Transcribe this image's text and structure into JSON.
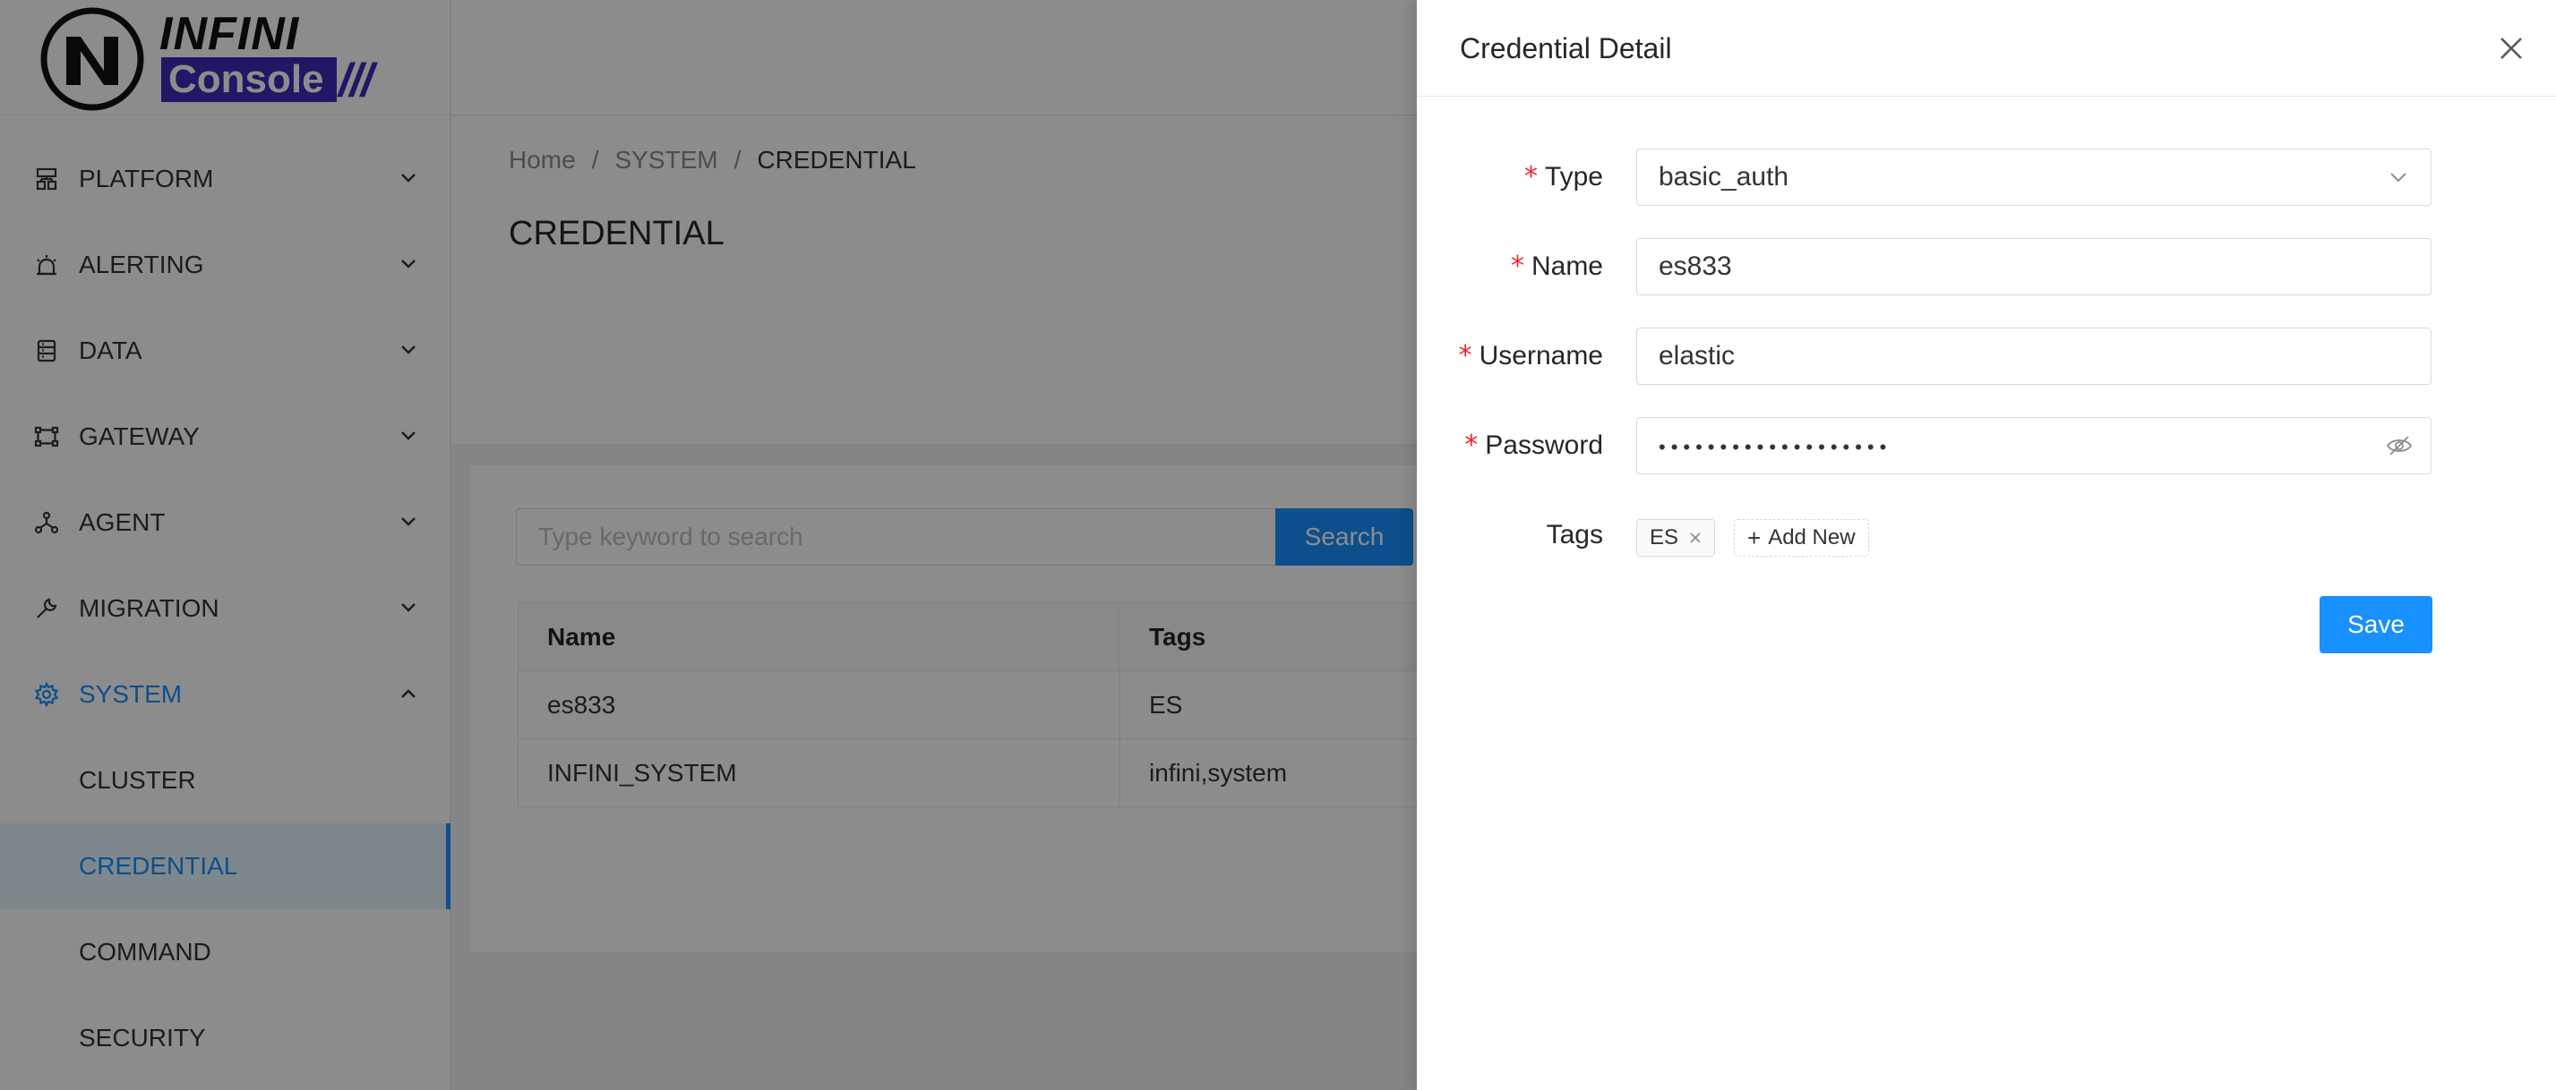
{
  "logo": {
    "top": "INFINI",
    "bottom": "Console",
    "slashes": "///"
  },
  "sidebar": {
    "items": [
      {
        "label": "PLATFORM",
        "icon": "platform-icon"
      },
      {
        "label": "ALERTING",
        "icon": "alarm-icon"
      },
      {
        "label": "DATA",
        "icon": "database-icon"
      },
      {
        "label": "GATEWAY",
        "icon": "gateway-icon"
      },
      {
        "label": "AGENT",
        "icon": "agent-icon"
      },
      {
        "label": "MIGRATION",
        "icon": "wrench-icon"
      },
      {
        "label": "SYSTEM",
        "icon": "gear-icon"
      }
    ],
    "system_children": [
      "CLUSTER",
      "CREDENTIAL",
      "COMMAND",
      "SECURITY"
    ]
  },
  "breadcrumb": [
    "Home",
    "/",
    "SYSTEM",
    "/",
    "CREDENTIAL"
  ],
  "page_title": "CREDENTIAL",
  "search": {
    "placeholder": "Type keyword to search",
    "button": "Search"
  },
  "table": {
    "headers": [
      "Name",
      "Tags"
    ],
    "rows": [
      [
        "es833",
        "ES"
      ],
      [
        "INFINI_SYSTEM",
        "infini,system"
      ]
    ]
  },
  "drawer": {
    "title": "Credential Detail",
    "required_mark": "*",
    "fields": {
      "type": {
        "label": "Type",
        "value": "basic_auth"
      },
      "name": {
        "label": "Name",
        "value": "es833"
      },
      "username": {
        "label": "Username",
        "value": "elastic"
      },
      "password": {
        "label": "Password",
        "value": "•••••••••••••••••••"
      },
      "tags": {
        "label": "Tags",
        "items": [
          "ES"
        ],
        "add_label": "Add New",
        "add_symbol": "+"
      }
    },
    "save_label": "Save"
  },
  "colors": {
    "primary": "#1890ff",
    "required": "#f5222d",
    "brand": "#3b2bb8"
  }
}
